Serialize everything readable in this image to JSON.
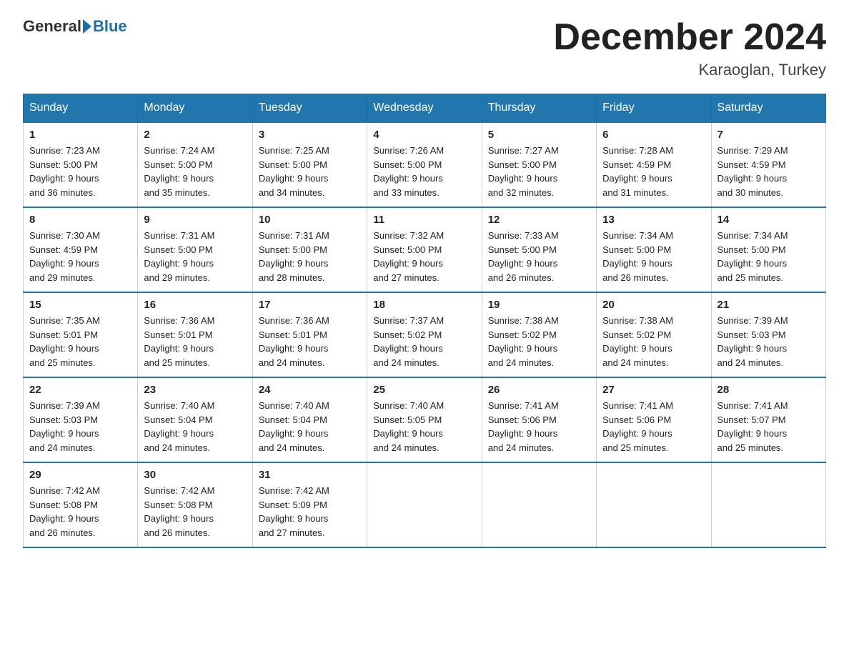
{
  "logo": {
    "general": "General",
    "blue": "Blue"
  },
  "title": "December 2024",
  "location": "Karaoglan, Turkey",
  "days_of_week": [
    "Sunday",
    "Monday",
    "Tuesday",
    "Wednesday",
    "Thursday",
    "Friday",
    "Saturday"
  ],
  "weeks": [
    [
      {
        "day": "1",
        "sunrise": "7:23 AM",
        "sunset": "5:00 PM",
        "daylight": "9 hours and 36 minutes."
      },
      {
        "day": "2",
        "sunrise": "7:24 AM",
        "sunset": "5:00 PM",
        "daylight": "9 hours and 35 minutes."
      },
      {
        "day": "3",
        "sunrise": "7:25 AM",
        "sunset": "5:00 PM",
        "daylight": "9 hours and 34 minutes."
      },
      {
        "day": "4",
        "sunrise": "7:26 AM",
        "sunset": "5:00 PM",
        "daylight": "9 hours and 33 minutes."
      },
      {
        "day": "5",
        "sunrise": "7:27 AM",
        "sunset": "5:00 PM",
        "daylight": "9 hours and 32 minutes."
      },
      {
        "day": "6",
        "sunrise": "7:28 AM",
        "sunset": "4:59 PM",
        "daylight": "9 hours and 31 minutes."
      },
      {
        "day": "7",
        "sunrise": "7:29 AM",
        "sunset": "4:59 PM",
        "daylight": "9 hours and 30 minutes."
      }
    ],
    [
      {
        "day": "8",
        "sunrise": "7:30 AM",
        "sunset": "4:59 PM",
        "daylight": "9 hours and 29 minutes."
      },
      {
        "day": "9",
        "sunrise": "7:31 AM",
        "sunset": "5:00 PM",
        "daylight": "9 hours and 29 minutes."
      },
      {
        "day": "10",
        "sunrise": "7:31 AM",
        "sunset": "5:00 PM",
        "daylight": "9 hours and 28 minutes."
      },
      {
        "day": "11",
        "sunrise": "7:32 AM",
        "sunset": "5:00 PM",
        "daylight": "9 hours and 27 minutes."
      },
      {
        "day": "12",
        "sunrise": "7:33 AM",
        "sunset": "5:00 PM",
        "daylight": "9 hours and 26 minutes."
      },
      {
        "day": "13",
        "sunrise": "7:34 AM",
        "sunset": "5:00 PM",
        "daylight": "9 hours and 26 minutes."
      },
      {
        "day": "14",
        "sunrise": "7:34 AM",
        "sunset": "5:00 PM",
        "daylight": "9 hours and 25 minutes."
      }
    ],
    [
      {
        "day": "15",
        "sunrise": "7:35 AM",
        "sunset": "5:01 PM",
        "daylight": "9 hours and 25 minutes."
      },
      {
        "day": "16",
        "sunrise": "7:36 AM",
        "sunset": "5:01 PM",
        "daylight": "9 hours and 25 minutes."
      },
      {
        "day": "17",
        "sunrise": "7:36 AM",
        "sunset": "5:01 PM",
        "daylight": "9 hours and 24 minutes."
      },
      {
        "day": "18",
        "sunrise": "7:37 AM",
        "sunset": "5:02 PM",
        "daylight": "9 hours and 24 minutes."
      },
      {
        "day": "19",
        "sunrise": "7:38 AM",
        "sunset": "5:02 PM",
        "daylight": "9 hours and 24 minutes."
      },
      {
        "day": "20",
        "sunrise": "7:38 AM",
        "sunset": "5:02 PM",
        "daylight": "9 hours and 24 minutes."
      },
      {
        "day": "21",
        "sunrise": "7:39 AM",
        "sunset": "5:03 PM",
        "daylight": "9 hours and 24 minutes."
      }
    ],
    [
      {
        "day": "22",
        "sunrise": "7:39 AM",
        "sunset": "5:03 PM",
        "daylight": "9 hours and 24 minutes."
      },
      {
        "day": "23",
        "sunrise": "7:40 AM",
        "sunset": "5:04 PM",
        "daylight": "9 hours and 24 minutes."
      },
      {
        "day": "24",
        "sunrise": "7:40 AM",
        "sunset": "5:04 PM",
        "daylight": "9 hours and 24 minutes."
      },
      {
        "day": "25",
        "sunrise": "7:40 AM",
        "sunset": "5:05 PM",
        "daylight": "9 hours and 24 minutes."
      },
      {
        "day": "26",
        "sunrise": "7:41 AM",
        "sunset": "5:06 PM",
        "daylight": "9 hours and 24 minutes."
      },
      {
        "day": "27",
        "sunrise": "7:41 AM",
        "sunset": "5:06 PM",
        "daylight": "9 hours and 25 minutes."
      },
      {
        "day": "28",
        "sunrise": "7:41 AM",
        "sunset": "5:07 PM",
        "daylight": "9 hours and 25 minutes."
      }
    ],
    [
      {
        "day": "29",
        "sunrise": "7:42 AM",
        "sunset": "5:08 PM",
        "daylight": "9 hours and 26 minutes."
      },
      {
        "day": "30",
        "sunrise": "7:42 AM",
        "sunset": "5:08 PM",
        "daylight": "9 hours and 26 minutes."
      },
      {
        "day": "31",
        "sunrise": "7:42 AM",
        "sunset": "5:09 PM",
        "daylight": "9 hours and 27 minutes."
      },
      null,
      null,
      null,
      null
    ]
  ],
  "labels": {
    "sunrise": "Sunrise:",
    "sunset": "Sunset:",
    "daylight": "Daylight:"
  }
}
